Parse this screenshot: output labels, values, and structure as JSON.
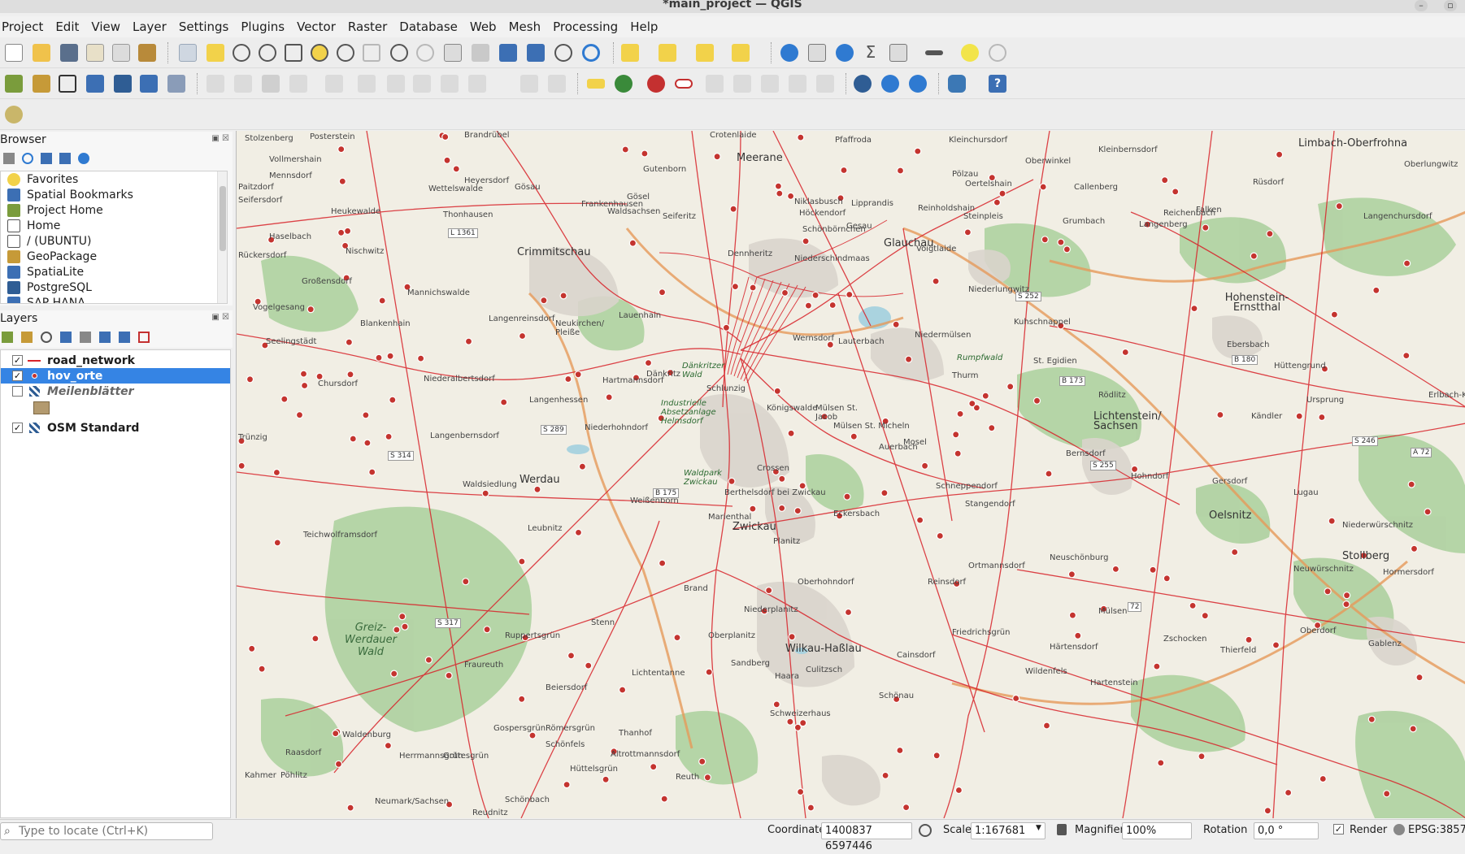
{
  "window": {
    "title": "*main_project — QGIS"
  },
  "menu": [
    "Project",
    "Edit",
    "View",
    "Layer",
    "Settings",
    "Plugins",
    "Vector",
    "Raster",
    "Database",
    "Web",
    "Mesh",
    "Processing",
    "Help"
  ],
  "browser": {
    "title": "Browser",
    "items": [
      "Favorites",
      "Spatial Bookmarks",
      "Project Home",
      "Home",
      "/ (UBUNTU)",
      "GeoPackage",
      "SpatiaLite",
      "PostgreSQL",
      "SAP HANA"
    ]
  },
  "layers": {
    "title": "Layers",
    "items": [
      {
        "name": "road_network",
        "checked": true
      },
      {
        "name": "hov_orte",
        "checked": true
      },
      {
        "name": "Meilenblätter",
        "checked": false
      },
      {
        "name": "OSM Standard",
        "checked": true
      }
    ]
  },
  "map_labels": {
    "cities": [
      "Crimmitschau",
      "Meerane",
      "Glauchau",
      "Zwickau",
      "Werdau",
      "Lichtenstein/ Sachsen",
      "Hohenstein-Ernstthal",
      "Oelsnitz",
      "Stollberg",
      "Wilkau-Haßlau",
      "Limbach-Oberfrohna"
    ],
    "places": [
      "Stolzenberg",
      "Posterstein",
      "Brandrübel",
      "Crotenlaide",
      "Pfaffroda",
      "Kleinchursdorf",
      "Oberwinkel",
      "Vollmershain",
      "Mennsdorf",
      "Paitzdorf",
      "Heyersdorf",
      "Gösau",
      "Frankenhausen",
      "Wettelswalde",
      "Heukewalde",
      "Thonhausen",
      "Haselbach",
      "Nischwitz",
      "Rückersdorf",
      "Großensdorf",
      "Mannichswalde",
      "Langenreinsdorf",
      "Neukirchen/ Pleiße",
      "Lauenhain",
      "Dänkritz",
      "Langenhessen",
      "Niederalbertsdorf",
      "Vogelgesang",
      "Blankenhain",
      "Seelingstädt",
      "Chursdorf",
      "Trünzig",
      "Langenbernsdorf",
      "Waldsiedlung",
      "Leubnitz",
      "Teichwolframsdorf",
      "Brand",
      "Marienthal",
      "Eckersbach",
      "Auerbach",
      "Schneppendorf",
      "Stangendorf",
      "Mülsen St. Jacob",
      "Mülsen St. Micheln",
      "Berthelsdorf bei Zwickau",
      "Crossen",
      "Niederhohndorf",
      "Weißenborn",
      "Hartmannsdorf",
      "Königswalde",
      "Lauterbach",
      "Mosel",
      "Niedermülsen",
      "Thurm",
      "Voigtlaide",
      "Wernsdorf",
      "Schlunzig",
      "Niederschindmaas",
      "Dennheritz",
      "Schönbörnchen",
      "Niklasbusch",
      "Lipprandis",
      "Reinholdshain",
      "Oertelshain",
      "Gesau",
      "Höckendorf",
      "Seiferitz",
      "Waldsachsen",
      "Gösel",
      "Gutenborn",
      "Callenberg",
      "Grumbach",
      "Langenberg",
      "Reichenbach",
      "Rüsdorf",
      "Falken",
      "Niederlungwitz",
      "Kuhschnappel",
      "St. Egidien",
      "Rödlitz",
      "Bernsdorf",
      "Hohndorf",
      "Gersdorf",
      "Lugau",
      "Niederwürschnitz",
      "Neuwürschnitz",
      "Hormersdorf",
      "Gablenz",
      "Oberdorf",
      "Thierfeld",
      "Zschocken",
      "Härtensdorf",
      "Hartenstein",
      "Wildenfels",
      "Ortmannsdorf",
      "Neuschönburg",
      "Mülsen",
      "Friedrichsgrün",
      "Reinsdorf",
      "Cainsdorf",
      "Planitz",
      "Oberhohndorf",
      "Niederplanitz",
      "Oberplanitz",
      "Sandberg",
      "Haara",
      "Culitzsch",
      "Schönau",
      "Schweizerhaus",
      "Fraureuth",
      "Ruppertsgrün",
      "Lichtentanne",
      "Stenn",
      "Thanhof",
      "Beiersdorf",
      "Gospersgrün",
      "Römersgrün",
      "Schönfels",
      "Altrottmannsdorf",
      "Hüttelsgrün",
      "Reuth",
      "Gottesgrün",
      "Herrmannsgrün",
      "Raasdorf",
      "Pöhlitz",
      "Kahmer",
      "Neumark/Sachsen",
      "Schönbach",
      "Reudnitz",
      "Waldenburg",
      "Seifersdorf",
      "Erlbach-Kirchberg",
      "Ursprung",
      "Kändler",
      "Oberlungwitz",
      "Hüttengrund",
      "Langenchursdorf",
      "Ebersbach",
      "Kleinbernsdorf",
      "Steinpleis",
      "Pölzau"
    ],
    "roads": [
      "L 1361",
      "S 289",
      "S 314",
      "S 317",
      "B 175",
      "S 252",
      "B 173",
      "B 180",
      "S 255",
      "S 246",
      "A 72",
      "72"
    ],
    "forests": [
      "Rumpfwald",
      "Dänkritzer Wald",
      "Waldpark Zwickau",
      "Industrielle Absetzanlage Helmsdorf"
    ],
    "big": "Greiz-Werdauer Wald"
  },
  "status": {
    "locate_placeholder": "Type to locate (Ctrl+K)",
    "coordinate_label": "Coordinate",
    "coordinate_value": "1400837  6597446",
    "scale_label": "Scale",
    "scale_value": "1:167681",
    "magnifier_label": "Magnifier",
    "magnifier_value": "100%",
    "rotation_label": "Rotation",
    "rotation_value": "0,0 °",
    "render_label": "Render",
    "crs": "EPSG:3857"
  },
  "colors": {
    "road": "#d8232a",
    "point_fill": "#c4342f",
    "forest": "#aed1a0",
    "selection": "#3584e4"
  }
}
